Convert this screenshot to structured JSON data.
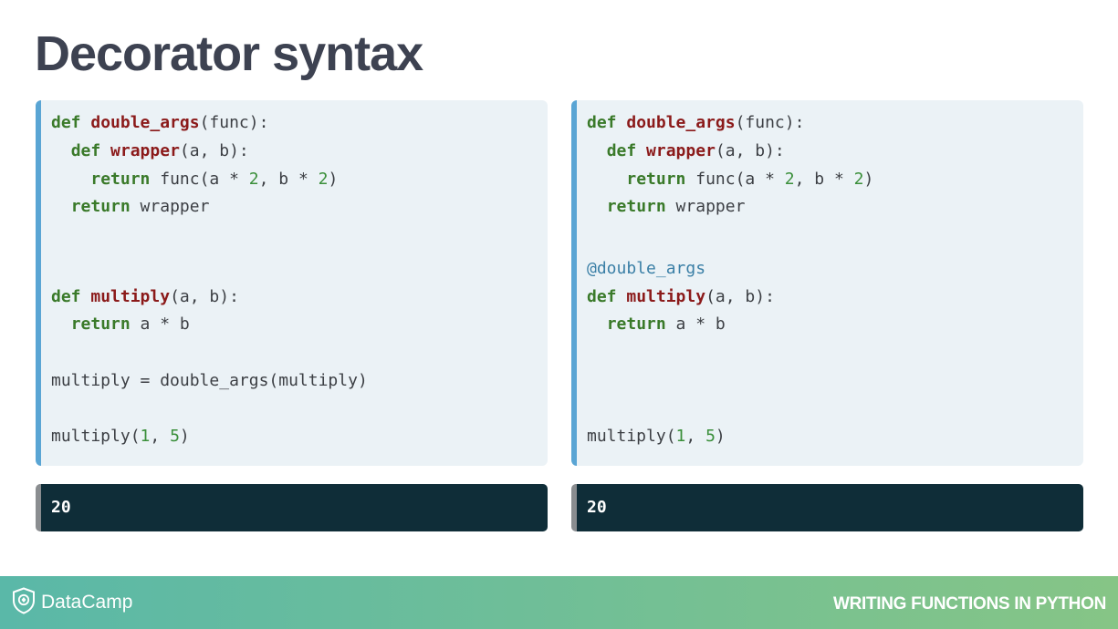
{
  "slide": {
    "title": "Decorator syntax"
  },
  "left_code": {
    "l1": {
      "kw": "def",
      "fn": "double_args",
      "rest": "(func):"
    },
    "l2": {
      "indent": "  ",
      "kw": "def",
      "fn": "wrapper",
      "rest": "(a, b):"
    },
    "l3": {
      "indent": "    ",
      "kw": "return",
      "a": " func(a * ",
      "n1": "2",
      "b": ", b * ",
      "n2": "2",
      "c": ")"
    },
    "l4": {
      "indent": "  ",
      "kw": "return",
      "rest": " wrapper"
    },
    "l5": {
      "kw": "def",
      "fn": "multiply",
      "rest": "(a, b):"
    },
    "l6": {
      "indent": "  ",
      "kw": "return",
      "rest": " a * b"
    },
    "l7": {
      "text": "multiply = double_args(multiply)"
    },
    "l8": {
      "a": "multiply(",
      "n1": "1",
      "b": ", ",
      "n2": "5",
      "c": ")"
    }
  },
  "right_code": {
    "l1": {
      "kw": "def",
      "fn": "double_args",
      "rest": "(func):"
    },
    "l2": {
      "indent": "  ",
      "kw": "def",
      "fn": "wrapper",
      "rest": "(a, b):"
    },
    "l3": {
      "indent": "    ",
      "kw": "return",
      "a": " func(a * ",
      "n1": "2",
      "b": ", b * ",
      "n2": "2",
      "c": ")"
    },
    "l4": {
      "indent": "  ",
      "kw": "return",
      "rest": " wrapper"
    },
    "l5": {
      "decorator": "@double_args"
    },
    "l6": {
      "kw": "def",
      "fn": "multiply",
      "rest": "(a, b):"
    },
    "l7": {
      "indent": "  ",
      "kw": "return",
      "rest": " a * b"
    },
    "l8": {
      "a": "multiply(",
      "n1": "1",
      "b": ", ",
      "n2": "5",
      "c": ")"
    }
  },
  "output": {
    "left": "20",
    "right": "20"
  },
  "footer": {
    "brand": "DataCamp",
    "logo_icon": "datacamp-shield-icon",
    "course": "WRITING FUNCTIONS IN PYTHON"
  },
  "colors": {
    "title": "#3d4251",
    "code_bg": "#ebf2f6",
    "code_border": "#5aa5d4",
    "keyword": "#3a7a2a",
    "function_name": "#8b1a1a",
    "number": "#3a8f3a",
    "decorator": "#3a7fa6",
    "output_bg": "#0f2d38",
    "footer_start": "#5ab8a8",
    "footer_end": "#86c586"
  }
}
